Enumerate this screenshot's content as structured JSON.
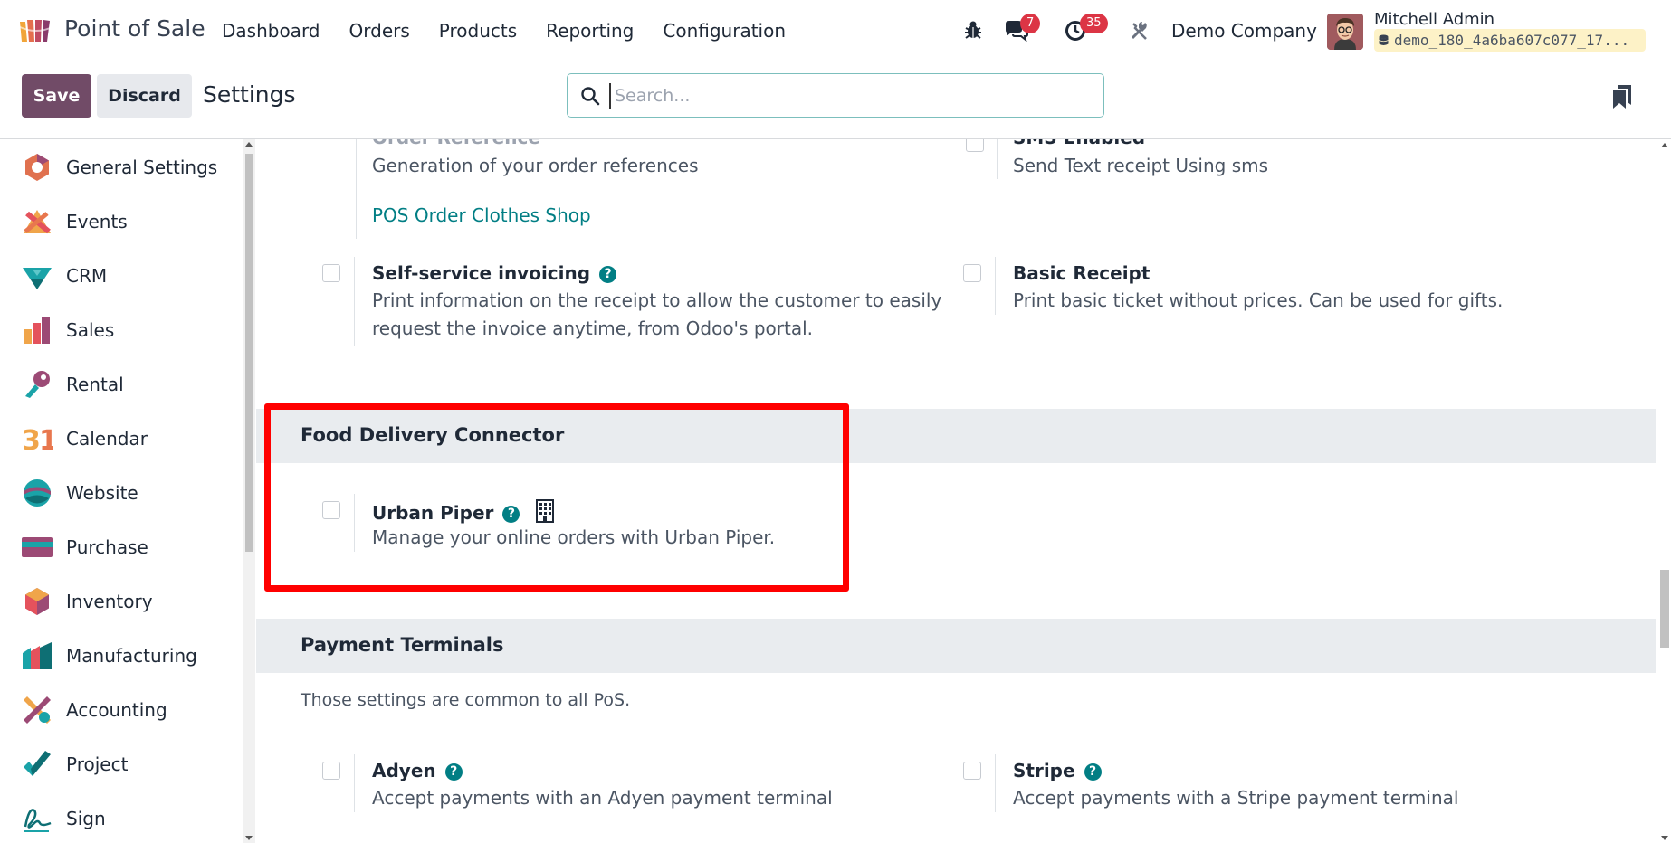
{
  "navbar": {
    "app_name": "Point of Sale",
    "menu": [
      "Dashboard",
      "Orders",
      "Products",
      "Reporting",
      "Configuration"
    ],
    "messages_count": "7",
    "activities_count": "35",
    "company": "Demo Company",
    "user_name": "Mitchell Admin",
    "database": "demo_180_4a6ba607c077_17..."
  },
  "control_panel": {
    "save_label": "Save",
    "discard_label": "Discard",
    "title": "Settings",
    "search_placeholder": "Search..."
  },
  "sidebar": {
    "items": [
      {
        "label": "General Settings",
        "icon": "general-settings-icon"
      },
      {
        "label": "Events",
        "icon": "events-icon"
      },
      {
        "label": "CRM",
        "icon": "crm-icon"
      },
      {
        "label": "Sales",
        "icon": "sales-icon"
      },
      {
        "label": "Rental",
        "icon": "rental-icon"
      },
      {
        "label": "Calendar",
        "icon": "calendar-icon"
      },
      {
        "label": "Website",
        "icon": "website-icon"
      },
      {
        "label": "Purchase",
        "icon": "purchase-icon"
      },
      {
        "label": "Inventory",
        "icon": "inventory-icon"
      },
      {
        "label": "Manufacturing",
        "icon": "manufacturing-icon"
      },
      {
        "label": "Accounting",
        "icon": "accounting-icon"
      },
      {
        "label": "Project",
        "icon": "project-icon"
      },
      {
        "label": "Sign",
        "icon": "sign-icon"
      }
    ]
  },
  "content": {
    "order_reference": {
      "title": "Order Reference",
      "desc": "Generation of your order references",
      "link": "POS Order Clothes Shop"
    },
    "sms_enabled": {
      "title": "SMS Enabled",
      "desc": "Send Text receipt Using sms"
    },
    "self_service": {
      "title": "Self-service invoicing",
      "desc": "Print information on the receipt to allow the customer to easily request the invoice anytime, from Odoo's portal."
    },
    "basic_receipt": {
      "title": "Basic Receipt",
      "desc": "Print basic ticket without prices. Can be used for gifts."
    },
    "food_delivery": {
      "section_title": "Food Delivery Connector",
      "urban_piper_title": "Urban Piper",
      "urban_piper_desc": "Manage your online orders with Urban Piper."
    },
    "payment_terminals": {
      "section_title": "Payment Terminals",
      "note": "Those settings are common to all PoS.",
      "adyen_title": "Adyen",
      "adyen_desc": "Accept payments with an Adyen payment terminal",
      "stripe_title": "Stripe",
      "stripe_desc": "Accept payments with a Stripe payment terminal"
    }
  },
  "colors": {
    "brand": "#714b67",
    "accent": "#017e84",
    "badge": "#dc3545",
    "highlight": "#ff0000"
  }
}
